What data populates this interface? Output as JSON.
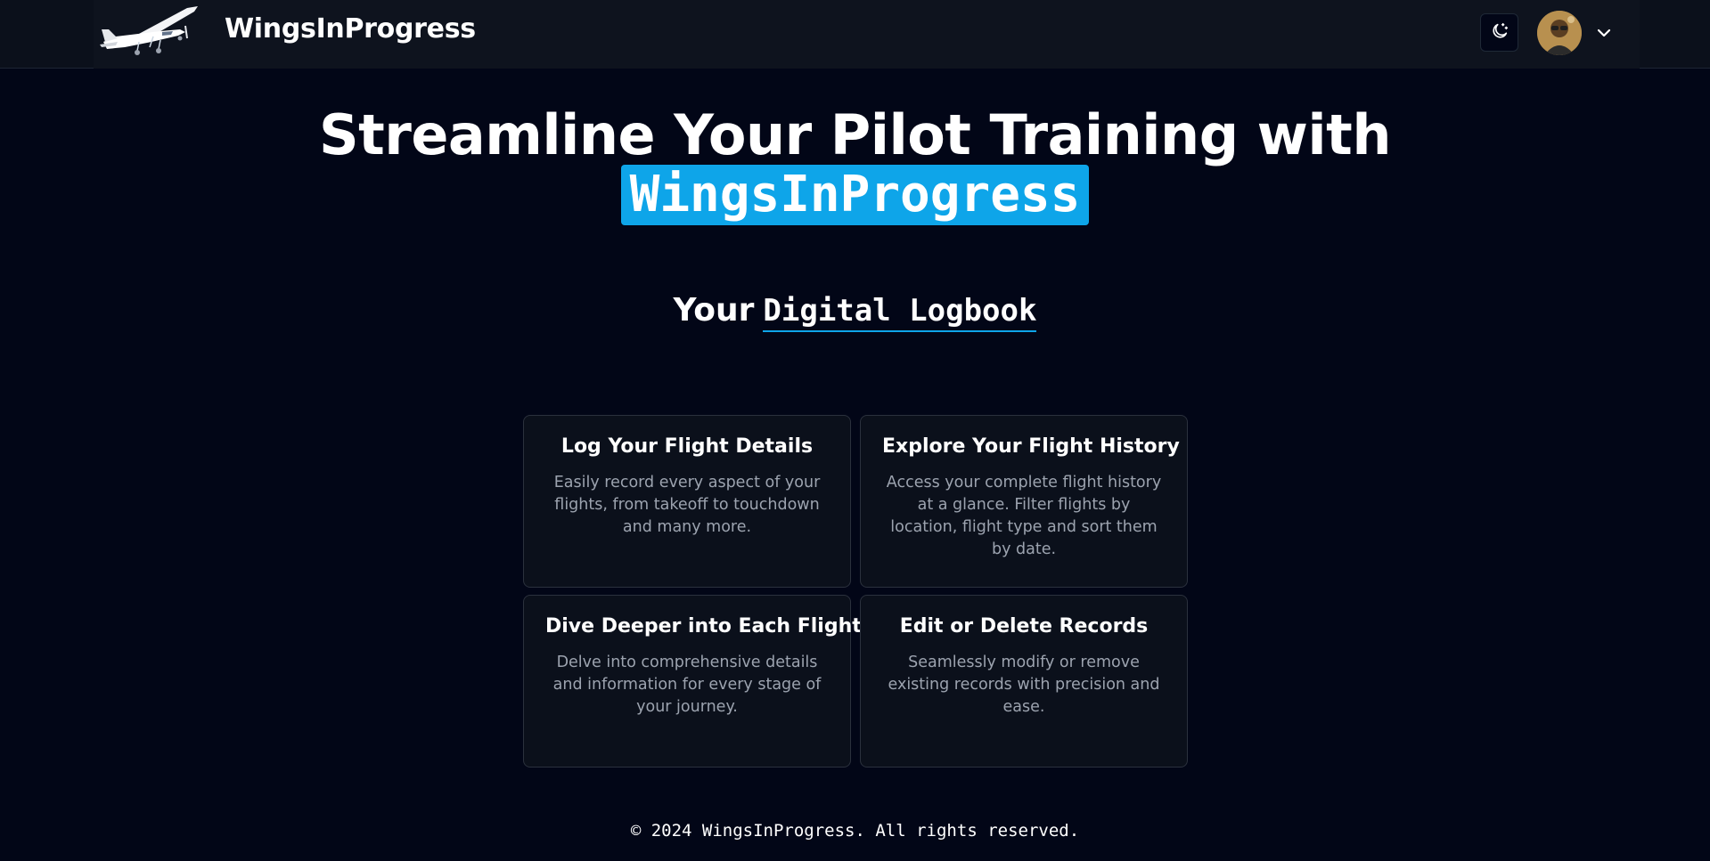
{
  "navbar": {
    "brand": "WingsInProgress",
    "logo_icon": "airplane-icon",
    "theme_toggle_icon": "moon-stars-icon",
    "avatar_icon": "user-avatar",
    "menu_icon": "chevron-down-icon"
  },
  "hero": {
    "title_line1": "Streamline Your Pilot Training with",
    "title_highlight": "WingsInProgress",
    "highlight_color": "#0ea5e9"
  },
  "subtitle": {
    "prefix": "Your",
    "emphasis": "Digital Logbook"
  },
  "features": [
    {
      "title": "Log Your Flight Details",
      "description": "Easily record every aspect of your flights, from takeoff to touchdown and many more."
    },
    {
      "title": "Explore Your Flight History",
      "description": "Access your complete flight history at a glance. Filter flights by location, flight type and sort them by date."
    },
    {
      "title": "Dive Deeper into Each Flight",
      "description": "Delve into comprehensive details and information for every stage of your journey."
    },
    {
      "title": "Edit or Delete Records",
      "description": "Seamlessly modify or remove existing records with precision and ease."
    }
  ],
  "footer": {
    "text": "© 2024 WingsInProgress. All rights reserved."
  },
  "colors": {
    "background": "#020617",
    "accent": "#0ea5e9",
    "card_border": "#2b313d",
    "muted_text": "#9ca3af"
  }
}
